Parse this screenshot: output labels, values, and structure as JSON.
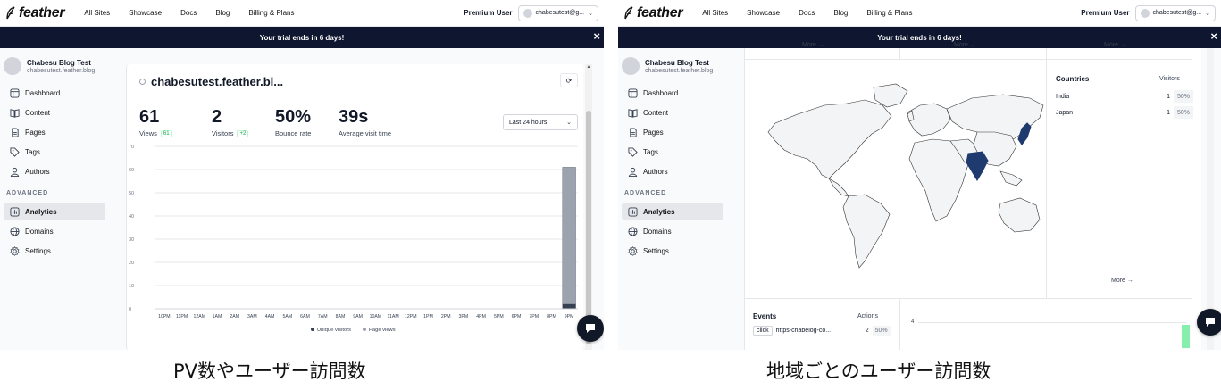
{
  "app": {
    "brand": "feather",
    "nav": [
      "All Sites",
      "Showcase",
      "Docs",
      "Blog",
      "Billing & Plans"
    ],
    "plan": "Premium User",
    "user_email": "chabesutest@g...",
    "trial_banner": "Your trial ends in 6 days!"
  },
  "sidebar": {
    "site_title": "Chabesu Blog Test",
    "site_url": "chabesutest.feather.blog",
    "items": [
      {
        "label": "Dashboard",
        "icon": "dashboard-icon"
      },
      {
        "label": "Content",
        "icon": "book-icon"
      },
      {
        "label": "Pages",
        "icon": "page-icon"
      },
      {
        "label": "Tags",
        "icon": "tag-icon"
      },
      {
        "label": "Authors",
        "icon": "user-icon"
      }
    ],
    "section_label": "ADVANCED",
    "advanced_items": [
      {
        "label": "Analytics",
        "icon": "analytics-icon",
        "active": true
      },
      {
        "label": "Domains",
        "icon": "globe-icon"
      },
      {
        "label": "Settings",
        "icon": "gear-icon"
      }
    ]
  },
  "dashboard": {
    "site_name": "chabesutest.feather.bl...",
    "stats": [
      {
        "value": "61",
        "label": "Views",
        "badge": "61"
      },
      {
        "value": "2",
        "label": "Visitors",
        "badge": "+2"
      },
      {
        "value": "50%",
        "label": "Bounce rate",
        "badge": ""
      },
      {
        "value": "39s",
        "label": "Average visit time",
        "badge": ""
      }
    ],
    "range": "Last 24 hours"
  },
  "chart_data": {
    "type": "bar",
    "categories": [
      "10PM",
      "11PM",
      "12AM",
      "1AM",
      "2AM",
      "3AM",
      "4AM",
      "5AM",
      "6AM",
      "7AM",
      "8AM",
      "9AM",
      "10AM",
      "11AM",
      "12PM",
      "1PM",
      "2PM",
      "3PM",
      "4PM",
      "5PM",
      "6PM",
      "7PM",
      "8PM",
      "9PM"
    ],
    "series": [
      {
        "name": "Unique visitors",
        "values": [
          0,
          0,
          0,
          0,
          0,
          0,
          0,
          0,
          0,
          0,
          0,
          0,
          0,
          0,
          0,
          0,
          0,
          0,
          0,
          0,
          0,
          0,
          0,
          2
        ],
        "color": "#374151"
      },
      {
        "name": "Page views",
        "values": [
          0,
          0,
          0,
          0,
          0,
          0,
          0,
          0,
          0,
          0,
          0,
          0,
          0,
          0,
          0,
          0,
          0,
          0,
          0,
          0,
          0,
          0,
          0,
          61
        ],
        "color": "#9ca3af"
      }
    ],
    "y_ticks": [
      "0",
      "10",
      "20",
      "30",
      "40",
      "50",
      "60",
      "70"
    ],
    "ylim": [
      0,
      70
    ],
    "grid": true,
    "legend": "bottom-center"
  },
  "map_page": {
    "more_label": "More →",
    "countries_title": "Countries",
    "visitors_title": "Visitors",
    "countries": [
      {
        "name": "India",
        "visitors": "1",
        "pct": "50%"
      },
      {
        "name": "Japan",
        "visitors": "1",
        "pct": "50%"
      }
    ],
    "highlight_color": "#1e3a6e",
    "events_title": "Events",
    "actions_title": "Actions",
    "events": [
      {
        "type": "click",
        "target": "https-chabelog-co...",
        "count": "2",
        "pct": "50%"
      }
    ],
    "mini_chart_tick": "4"
  },
  "captions": {
    "left": "PV数やユーザー訪問数",
    "right": "地域ごとのユーザー訪問数"
  }
}
